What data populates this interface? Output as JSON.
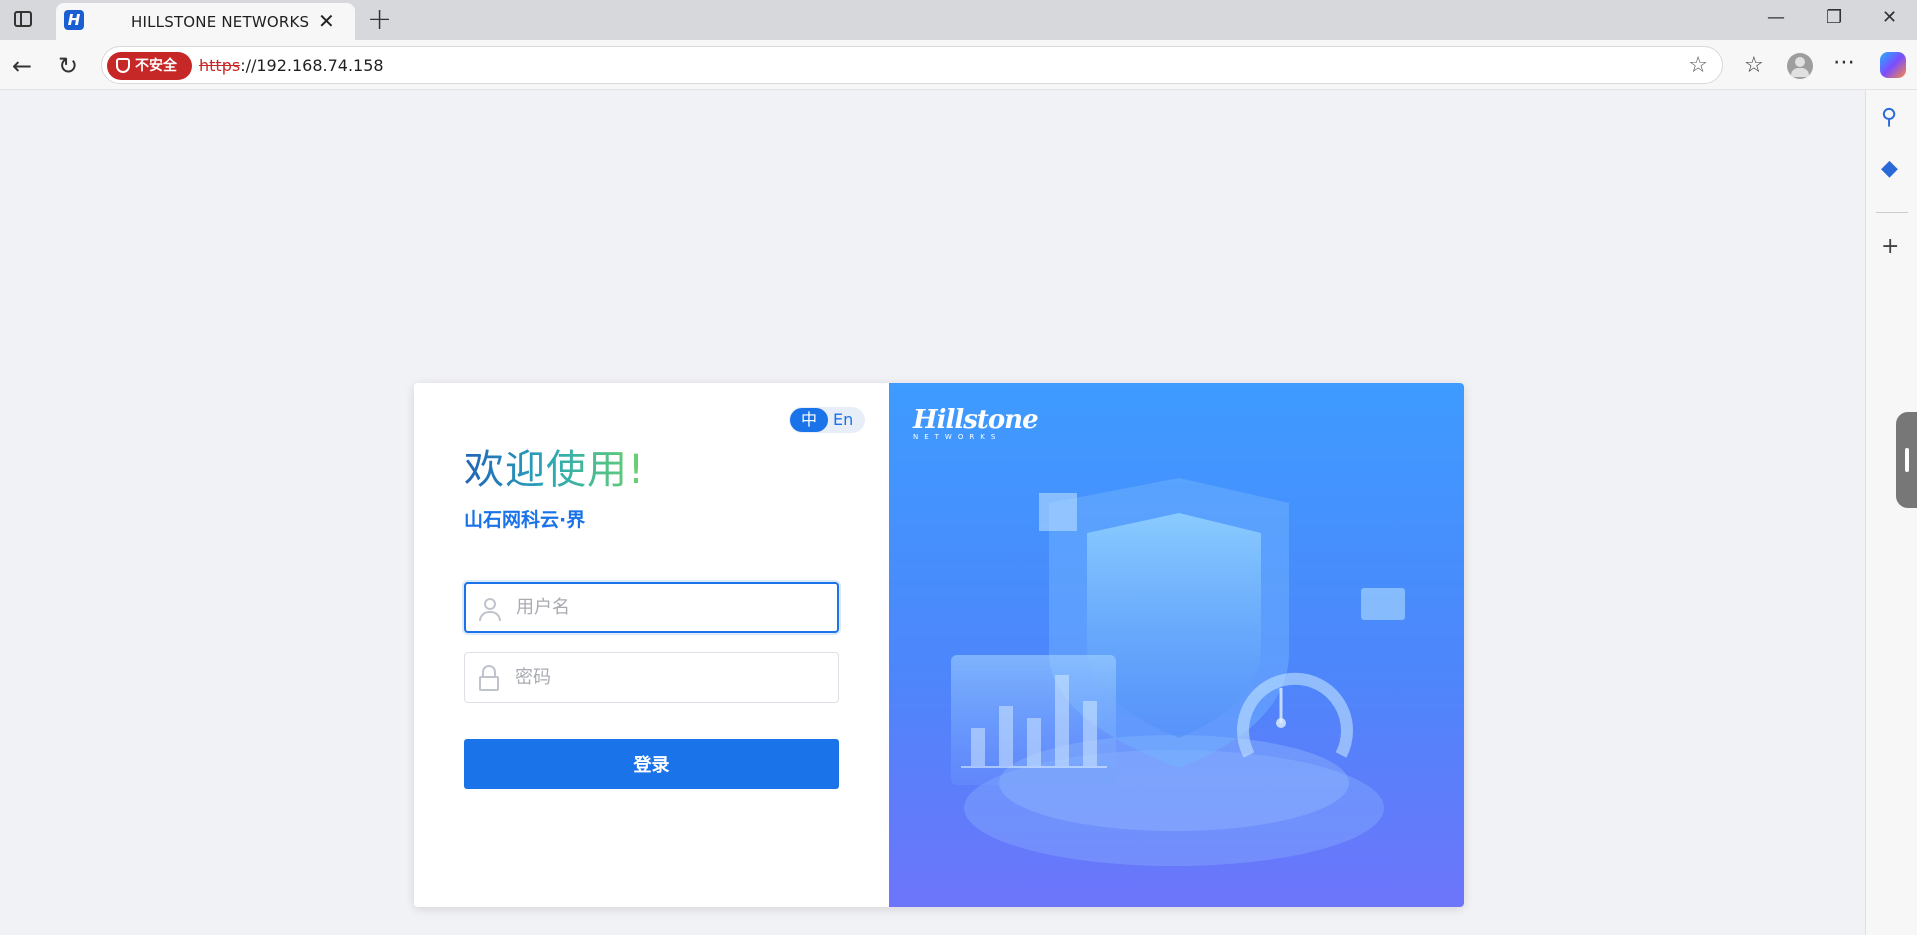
{
  "browser": {
    "tab_title": "HILLSTONE NETWORKS",
    "tab_favicon": "H",
    "security_label": "不安全",
    "url_scheme": "https",
    "url_rest": "://192.168.74.158",
    "icons": {
      "sidebar_toggle": "tab-actions-icon",
      "close": "close-icon",
      "new_tab": "plus-icon",
      "back": "back-arrow-icon",
      "refresh": "refresh-icon",
      "favorite": "star-icon",
      "favorites": "favorites-icon",
      "more": "more-icon",
      "copilot": "copilot-icon",
      "search": "search-icon",
      "tag": "tag-icon",
      "add": "plus-icon"
    }
  },
  "login": {
    "lang_zh": "中",
    "lang_en": "En",
    "welcome": "欢迎使用!",
    "subtitle": "山石网科云·界",
    "username_placeholder": "用户名",
    "password_placeholder": "密码",
    "login_button": "登录"
  },
  "brand": {
    "name": "Hillstone",
    "sub": "NETWORKS"
  },
  "colors": {
    "primary": "#1a73e8",
    "insecure": "#c62828",
    "hero_top": "#3e9bff",
    "hero_bottom": "#6d75fb"
  }
}
